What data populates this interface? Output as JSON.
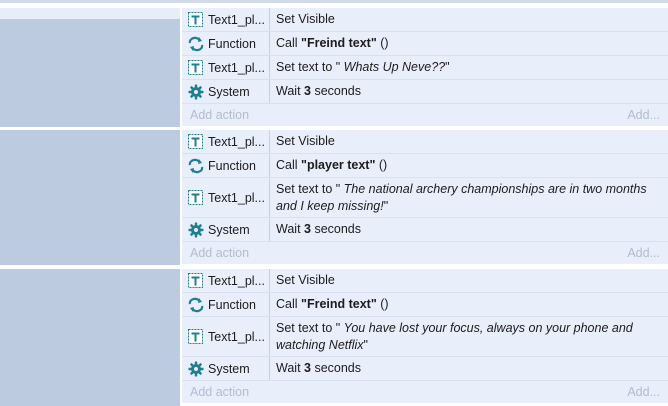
{
  "events": [
    {
      "actions": [
        {
          "object": "Text1_pl...",
          "icon": "text-object-icon",
          "parts": [
            {
              "t": "Set Visible"
            }
          ]
        },
        {
          "object": "Function",
          "icon": "function-icon",
          "parts": [
            {
              "t": "Call "
            },
            {
              "t": "\"Freind text\"",
              "b": true
            },
            {
              "t": " ()"
            }
          ]
        },
        {
          "object": "Text1_pl...",
          "icon": "text-object-icon",
          "parts": [
            {
              "t": "Set text to \" "
            },
            {
              "t": "Whats Up Neve??",
              "i": true
            },
            {
              "t": "\""
            }
          ]
        },
        {
          "object": "System",
          "icon": "system-gear-icon",
          "parts": [
            {
              "t": "Wait "
            },
            {
              "t": "3",
              "b": true
            },
            {
              "t": " seconds"
            }
          ]
        }
      ],
      "add_action": "Add action",
      "add_right": "Add..."
    },
    {
      "actions": [
        {
          "object": "Text1_pl...",
          "icon": "text-object-icon",
          "parts": [
            {
              "t": "Set Visible"
            }
          ]
        },
        {
          "object": "Function",
          "icon": "function-icon",
          "parts": [
            {
              "t": "Call "
            },
            {
              "t": "\"player text\"",
              "b": true
            },
            {
              "t": " ()"
            }
          ]
        },
        {
          "object": "Text1_pl...",
          "icon": "text-object-icon",
          "parts": [
            {
              "t": "Set text to \" "
            },
            {
              "t": "The national archery championships are in two months and I keep missing!",
              "i": true
            },
            {
              "t": "\""
            }
          ]
        },
        {
          "object": "System",
          "icon": "system-gear-icon",
          "parts": [
            {
              "t": "Wait "
            },
            {
              "t": "3",
              "b": true
            },
            {
              "t": " seconds"
            }
          ]
        }
      ],
      "add_action": "Add action",
      "add_right": "Add..."
    },
    {
      "actions": [
        {
          "object": "Text1_pl...",
          "icon": "text-object-icon",
          "parts": [
            {
              "t": "Set Visible"
            }
          ]
        },
        {
          "object": "Function",
          "icon": "function-icon",
          "parts": [
            {
              "t": "Call "
            },
            {
              "t": "\"Freind text\"",
              "b": true
            },
            {
              "t": " ()"
            }
          ]
        },
        {
          "object": "Text1_pl...",
          "icon": "text-object-icon",
          "parts": [
            {
              "t": "Set text to \" "
            },
            {
              "t": "You have lost your focus, always on your phone and watching Netflix",
              "i": true
            },
            {
              "t": "\""
            }
          ]
        },
        {
          "object": "System",
          "icon": "system-gear-icon",
          "parts": [
            {
              "t": "Wait "
            },
            {
              "t": "3",
              "b": true
            },
            {
              "t": " seconds"
            }
          ]
        }
      ],
      "add_action": "Add action",
      "add_right": "Add..."
    }
  ],
  "colors": {
    "condition_panel": "#bccbdf",
    "action_panel": "#e9eefb",
    "icon_teal": "#1f7f8f"
  }
}
